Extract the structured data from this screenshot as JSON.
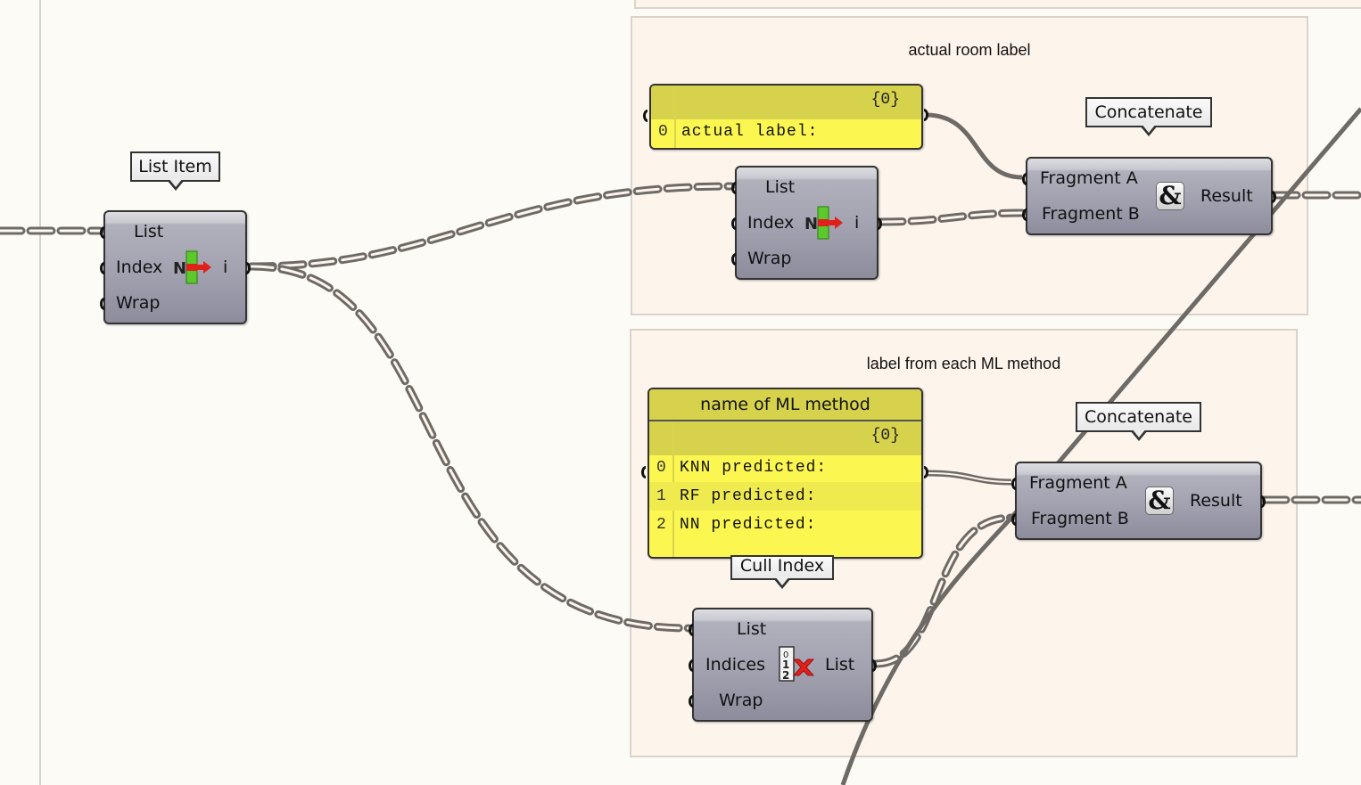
{
  "canvas": {
    "background": "#fdfbf6",
    "group_fill": "#fdf5ec",
    "wire_color": "#6e6a66",
    "component_color": "#a3a3b1",
    "panel_color": "#fcf750"
  },
  "groups": [
    {
      "id": "top-group",
      "title": ""
    },
    {
      "id": "actual-room-label-group",
      "title": "actual room label"
    },
    {
      "id": "ml-method-group",
      "title": "label from each ML method"
    }
  ],
  "components": {
    "list_item_main": {
      "tag": "List Item",
      "inputs": [
        "List",
        "Index",
        "Wrap"
      ],
      "outputs": [
        "i"
      ],
      "icon": "list-item-icon"
    },
    "list_item_room": {
      "tag": "",
      "inputs": [
        "List",
        "Index",
        "Wrap"
      ],
      "outputs": [
        "i"
      ],
      "icon": "list-item-icon"
    },
    "concat_top": {
      "tag": "Concatenate",
      "inputs": [
        "Fragment A",
        "Fragment B"
      ],
      "outputs": [
        "Result"
      ],
      "icon": "ampersand-icon",
      "icon_glyph": "&"
    },
    "concat_bottom": {
      "tag": "Concatenate",
      "inputs": [
        "Fragment A",
        "Fragment B"
      ],
      "outputs": [
        "Result"
      ],
      "icon": "ampersand-icon",
      "icon_glyph": "&"
    },
    "cull_index": {
      "tag": "Cull Index",
      "inputs": [
        "List",
        "Indices",
        "Wrap"
      ],
      "outputs": [
        "List"
      ],
      "icon": "cull-index-icon"
    }
  },
  "panels": {
    "actual_label": {
      "title": "",
      "path": "{0}",
      "rows": [
        {
          "index": "0",
          "text": "actual label:"
        }
      ]
    },
    "ml_method": {
      "title": "name of ML method",
      "path": "{0}",
      "rows": [
        {
          "index": "0",
          "text": "KNN predicted:"
        },
        {
          "index": "1",
          "text": "RF predicted:"
        },
        {
          "index": "2",
          "text": "NN predicted:"
        }
      ]
    }
  },
  "icon_text": {
    "list_item_n": "N"
  }
}
